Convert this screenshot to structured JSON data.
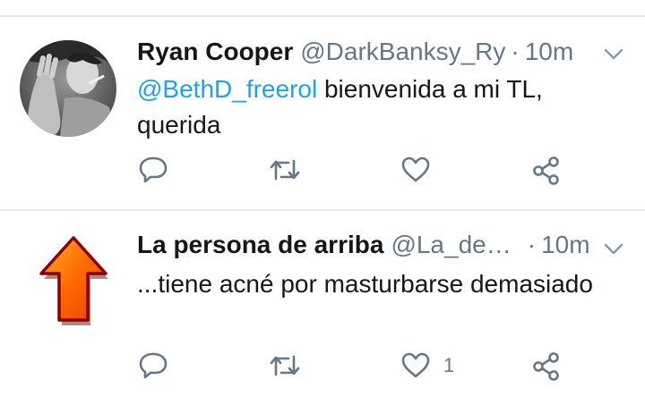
{
  "tweets": [
    {
      "name": "Ryan Cooper",
      "handle": "@DarkBanksy_Ry",
      "separator": "·",
      "time": "10m",
      "mention": "@BethD_freerol",
      "text_line1": " bienvenida a mi TL,",
      "text_line2": "querida",
      "like_count": ""
    },
    {
      "name": "La persona de arriba",
      "handle": "@La_de…",
      "separator": "·",
      "time": "10m",
      "text": "...tiene acné por masturbarse demasiado",
      "like_count": "1"
    }
  ],
  "icons": {
    "reply": "reply-icon",
    "retweet": "retweet-icon",
    "like": "heart-icon",
    "share": "share-icon",
    "more": "chevron-down-icon",
    "arrow": "up-arrow-icon"
  },
  "colors": {
    "mention": "#1da1f2",
    "secondary_text": "#657786",
    "divider": "#e6ecf0",
    "arrow_fill": "#ff6a00",
    "arrow_outline": "#8b0000"
  }
}
